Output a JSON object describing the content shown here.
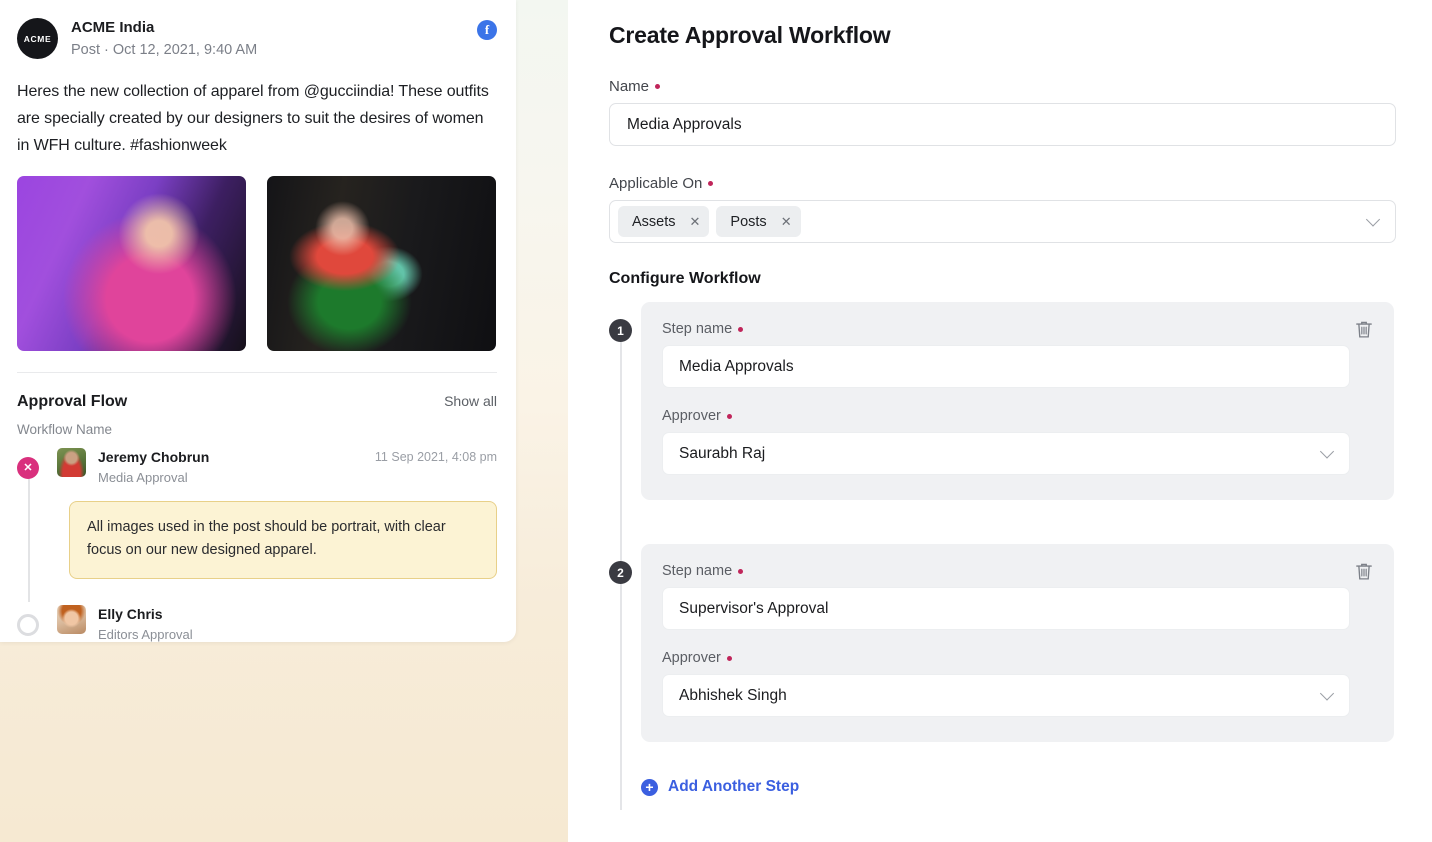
{
  "post": {
    "logo_text": "ACME",
    "brand": "ACME India",
    "meta": "Post · Oct 12, 2021, 9:40 AM",
    "network_icon": "facebook-icon",
    "network_glyph": "f",
    "body": "Heres the new collection of apparel from @gucciindia! These outfits are specially created by our designers to suit the desires of women in WFH culture. #fashionweek",
    "images": [
      {
        "alt": "woman-in-pink-sweater-purple-light"
      },
      {
        "alt": "runway-fashion-show-models"
      }
    ]
  },
  "approval_flow": {
    "title": "Approval Flow",
    "show_all": "Show all",
    "workflow_name_label": "Workflow Name",
    "items": [
      {
        "name": "Jeremy Chobrun",
        "role": "Media Approval",
        "time": "11 Sep 2021, 4:08 pm",
        "status": "rejected",
        "status_glyph": "✕",
        "note": "All images used in the post should be portrait, with clear focus on our new designed apparel."
      },
      {
        "name": "Elly Chris",
        "role": "Editors Approval",
        "time": "",
        "status": "pending",
        "status_glyph": ""
      }
    ]
  },
  "form": {
    "title": "Create Approval Workflow",
    "name": {
      "label": "Name",
      "value": "Media Approvals",
      "placeholder": "Media Approvals",
      "required": true
    },
    "applicable_on": {
      "label": "Applicable On",
      "required": true,
      "chips": [
        {
          "label": "Assets",
          "remove_glyph": "✕"
        },
        {
          "label": "Posts",
          "remove_glyph": "✕"
        }
      ]
    },
    "configure_title": "Configure Workflow",
    "steps": [
      {
        "number": "1",
        "step_name_label": "Step name",
        "step_name_value": "Media Approvals",
        "approver_label": "Approver",
        "approver_value": "Saurabh Raj",
        "delete_icon": "trash-icon"
      },
      {
        "number": "2",
        "step_name_label": "Step name",
        "step_name_value": "Supervisor's Approval",
        "approver_label": "Approver",
        "approver_value": "Abhishek Singh",
        "delete_icon": "trash-icon"
      }
    ],
    "add_step": {
      "label": "Add Another Step",
      "glyph": "+"
    }
  },
  "colors": {
    "accent_blue": "#3b5fe0",
    "facebook_blue": "#3b74e8",
    "required_red": "#c0255a",
    "reject_pink": "#d9307d",
    "note_bg": "#fcf3d4",
    "note_border": "#e8d089",
    "step_card_bg": "#f0f1f3",
    "badge_dark": "#3a3b42"
  }
}
